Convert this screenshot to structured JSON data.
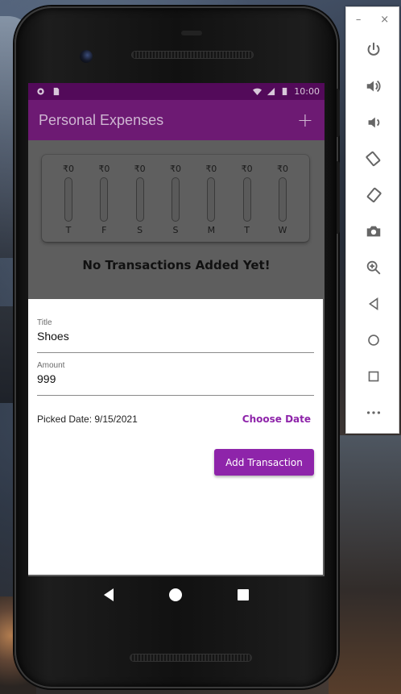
{
  "status_bar": {
    "time": "10:00"
  },
  "app_bar": {
    "title": "Personal Expenses",
    "add_icon": "+"
  },
  "chart": {
    "days": [
      {
        "day": "T",
        "amount": "₹0",
        "fraction": 0
      },
      {
        "day": "F",
        "amount": "₹0",
        "fraction": 0
      },
      {
        "day": "S",
        "amount": "₹0",
        "fraction": 0
      },
      {
        "day": "S",
        "amount": "₹0",
        "fraction": 0
      },
      {
        "day": "M",
        "amount": "₹0",
        "fraction": 0
      },
      {
        "day": "T",
        "amount": "₹0",
        "fraction": 0
      },
      {
        "day": "W",
        "amount": "₹0",
        "fraction": 0
      }
    ]
  },
  "empty_message": "No Transactions Added Yet!",
  "form": {
    "title_label": "Title",
    "title_value": "Shoes",
    "amount_label": "Amount",
    "amount_value": "999",
    "picked_date": "Picked Date: 9/15/2021",
    "choose_date": "Choose Date",
    "submit": "Add Transaction"
  },
  "emulator_toolbar": {
    "minimize": "–",
    "close": "×",
    "items": [
      "power-icon",
      "volume-up-icon",
      "volume-down-icon",
      "rotate-left-icon",
      "rotate-right-icon",
      "camera-icon",
      "zoom-icon",
      "back-icon",
      "home-icon",
      "overview-icon",
      "more-icon"
    ]
  },
  "colors": {
    "primary": "#8e24aa",
    "appbar": "#6d1a73",
    "statusbar": "#530a5a"
  }
}
